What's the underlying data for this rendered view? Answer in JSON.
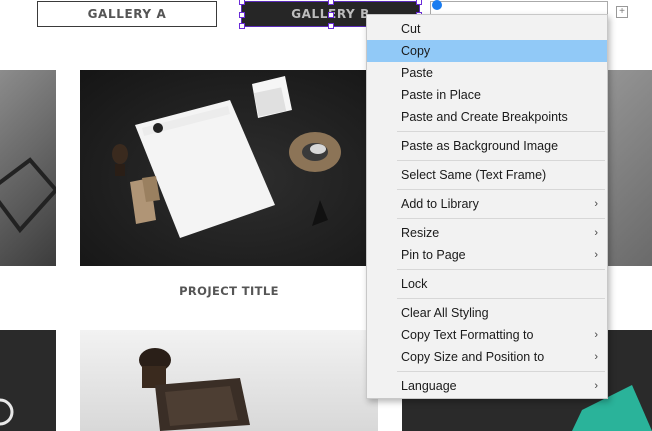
{
  "tabs": {
    "gallery_a": "GALLERY A",
    "gallery_b": "GALLERY B"
  },
  "project": {
    "title": "PROJECT TITLE"
  },
  "context_menu": {
    "groups": [
      [
        {
          "label": "Cut",
          "submenu": false,
          "highlighted": false
        },
        {
          "label": "Copy",
          "submenu": false,
          "highlighted": true
        },
        {
          "label": "Paste",
          "submenu": false,
          "highlighted": false
        },
        {
          "label": "Paste in Place",
          "submenu": false,
          "highlighted": false
        },
        {
          "label": "Paste and Create Breakpoints",
          "submenu": false,
          "highlighted": false
        }
      ],
      [
        {
          "label": "Paste as Background Image",
          "submenu": false,
          "highlighted": false
        }
      ],
      [
        {
          "label": "Select Same (Text Frame)",
          "submenu": false,
          "highlighted": false
        }
      ],
      [
        {
          "label": "Add to Library",
          "submenu": true,
          "highlighted": false
        }
      ],
      [
        {
          "label": "Resize",
          "submenu": true,
          "highlighted": false
        },
        {
          "label": "Pin to Page",
          "submenu": true,
          "highlighted": false
        }
      ],
      [
        {
          "label": "Lock",
          "submenu": false,
          "highlighted": false
        }
      ],
      [
        {
          "label": "Clear All Styling",
          "submenu": false,
          "highlighted": false
        },
        {
          "label": "Copy Text Formatting to",
          "submenu": true,
          "highlighted": false
        },
        {
          "label": "Copy Size and Position to",
          "submenu": true,
          "highlighted": false
        }
      ],
      [
        {
          "label": "Language",
          "submenu": true,
          "highlighted": false
        }
      ]
    ],
    "highlight_color": "#91c9f7"
  },
  "colors": {
    "selection": "#6a2cd8",
    "accent": "#1a7cf0"
  }
}
